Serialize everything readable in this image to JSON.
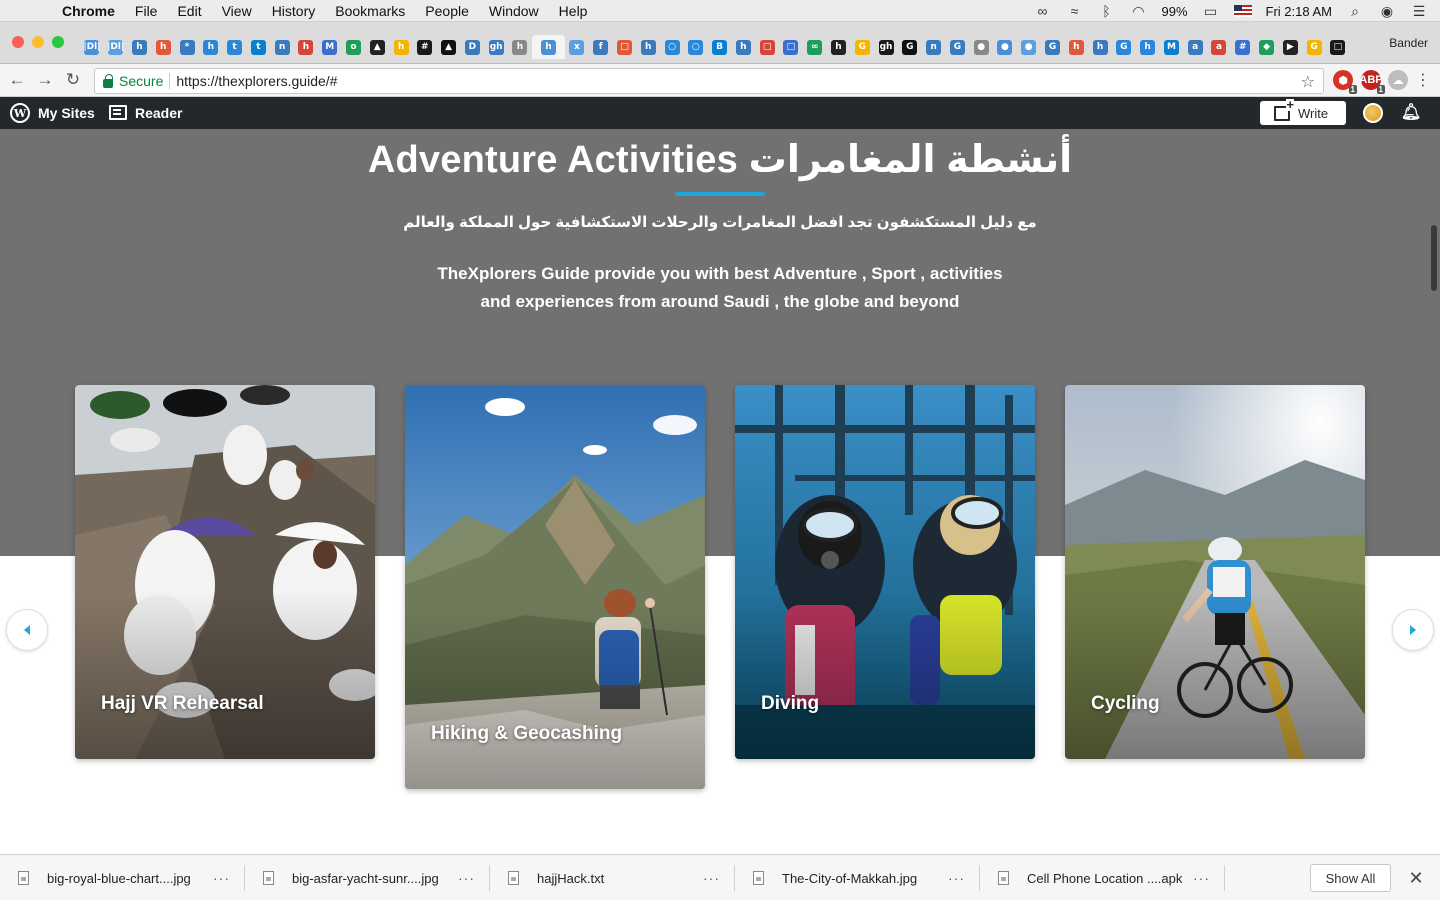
{
  "menubar": {
    "app_name": "Chrome",
    "items": [
      "File",
      "Edit",
      "View",
      "History",
      "Bookmarks",
      "People",
      "Window",
      "Help"
    ],
    "battery": "99%",
    "clock": "Fri 2:18 AM"
  },
  "browser": {
    "profile_name": "Bander",
    "tab_icons": [
      "|Dl|",
      "|Dl|",
      "h",
      "h",
      "*",
      "h",
      "t",
      "t",
      "n",
      "h",
      "M",
      "o",
      "▲",
      "h",
      "#",
      "▲",
      "D",
      "gh",
      "h",
      "h",
      "x",
      "f",
      "□",
      "h",
      "○",
      "○",
      "B",
      "h",
      "□",
      "□",
      "∞",
      "h",
      "G",
      "gh",
      "G",
      "n",
      "G",
      "●",
      "●",
      "●",
      "G",
      "h",
      "h",
      "G",
      "h",
      "M",
      "a",
      "a",
      "#",
      "◆",
      "▶",
      "G",
      "□"
    ],
    "address": {
      "secure_label": "Secure",
      "url": "https://thexplorers.guide/#"
    },
    "extensions": {
      "ext1_badge": "1",
      "ext2_badge": "1"
    }
  },
  "wp_admin_bar": {
    "my_sites": "My Sites",
    "reader": "Reader",
    "write": "Write"
  },
  "page": {
    "title": "Adventure Activities أنشطة المغامرات",
    "arabic_subtitle": "مع دليل المستكشفون تجد افضل المغامرات والرحلات الاستكشافية حول المملكة والعالم",
    "description": "TheXplorers Guide provide you with best Adventure , Sport , activities and experiences from around Saudi , the globe and beyond",
    "cards": [
      {
        "title": "Hajj VR Rehearsal",
        "image": "pilgrims-on-rocks"
      },
      {
        "title": "Hiking & Geocashing",
        "image": "hiker-on-mountain"
      },
      {
        "title": "Diving",
        "image": "divers-underwater"
      },
      {
        "title": "Cycling",
        "image": "cyclist-on-road"
      }
    ],
    "colors": {
      "hero_background": "#717171",
      "accent": "#1ea7d8"
    }
  },
  "downloads": {
    "items": [
      {
        "name": "big-royal-blue-chart....jpg"
      },
      {
        "name": "big-asfar-yacht-sunr....jpg"
      },
      {
        "name": "hajjHack.txt"
      },
      {
        "name": "The-City-of-Makkah.jpg"
      },
      {
        "name": "Cell Phone Location ....apk"
      }
    ],
    "more_label": "···",
    "show_all": "Show All"
  }
}
